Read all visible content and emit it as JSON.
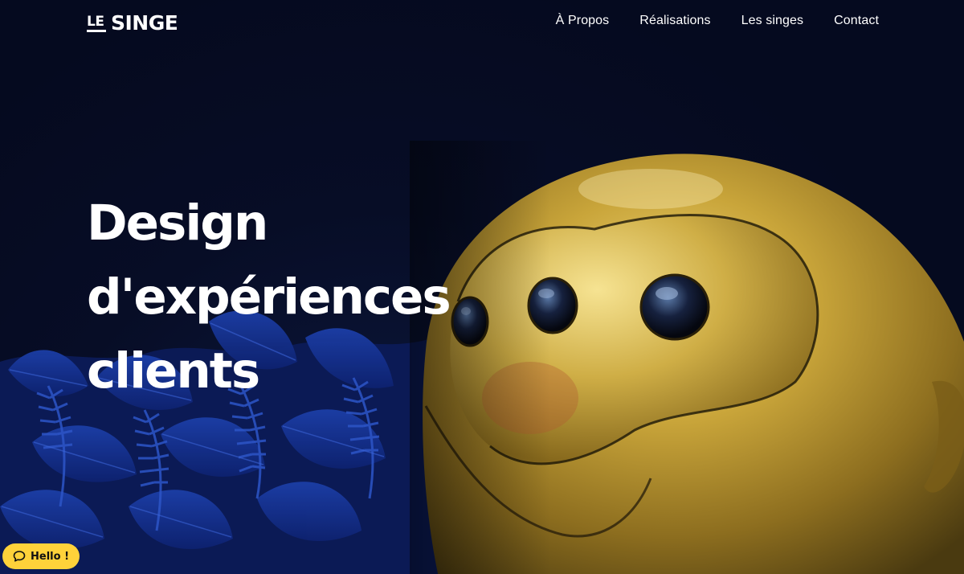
{
  "brand": {
    "logo_le": "LE",
    "logo_main": "SINGE"
  },
  "nav": {
    "items": [
      {
        "label": "À Propos"
      },
      {
        "label": "Réalisations"
      },
      {
        "label": "Les singes"
      },
      {
        "label": "Contact"
      }
    ]
  },
  "hero": {
    "line1": "Design",
    "line2": "d'expériences",
    "line3": "clients"
  },
  "chat": {
    "label": "Hello !",
    "icon": "chat-bubble-icon"
  },
  "colors": {
    "background": "#050a1f",
    "accent_yellow": "#ffd23a",
    "gold": "#c9a53a",
    "jungle_blue": "#1a3a9c"
  }
}
